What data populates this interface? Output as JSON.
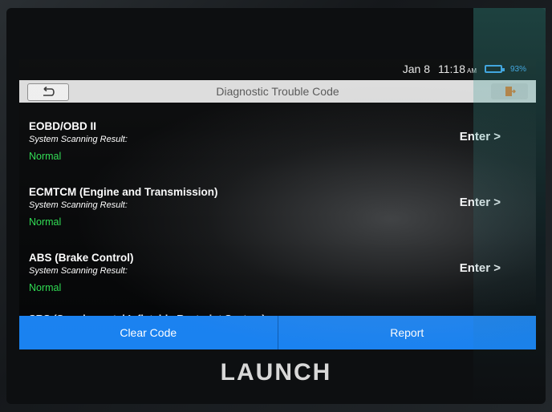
{
  "status_bar": {
    "date": "Jan 8",
    "time": "11:18",
    "ampm": "AM",
    "battery": "93%"
  },
  "header": {
    "title": "Diagnostic Trouble Code"
  },
  "systems": [
    {
      "name": "EOBD/OBD II",
      "label": "System Scanning Result:",
      "status": "Normal",
      "action": "Enter >"
    },
    {
      "name": "ECMTCM (Engine and Transmission)",
      "label": "System Scanning Result:",
      "status": "Normal",
      "action": "Enter >"
    },
    {
      "name": "ABS (Brake Control)",
      "label": "System Scanning Result:",
      "status": "Normal",
      "action": "Enter >"
    }
  ],
  "partial_item": "SRS (Supplemental Inflatable Restraint System)",
  "footer": {
    "clear_label": "Clear Code",
    "report_label": "Report"
  },
  "device": {
    "brand": "LAUNCH"
  },
  "colors": {
    "accent": "#1a82f0",
    "status_ok": "#2edc52",
    "battery": "#3fa9ff"
  },
  "icons": {
    "back": "back-arrow-icon",
    "exit": "exit-door-icon",
    "battery": "battery-icon"
  }
}
